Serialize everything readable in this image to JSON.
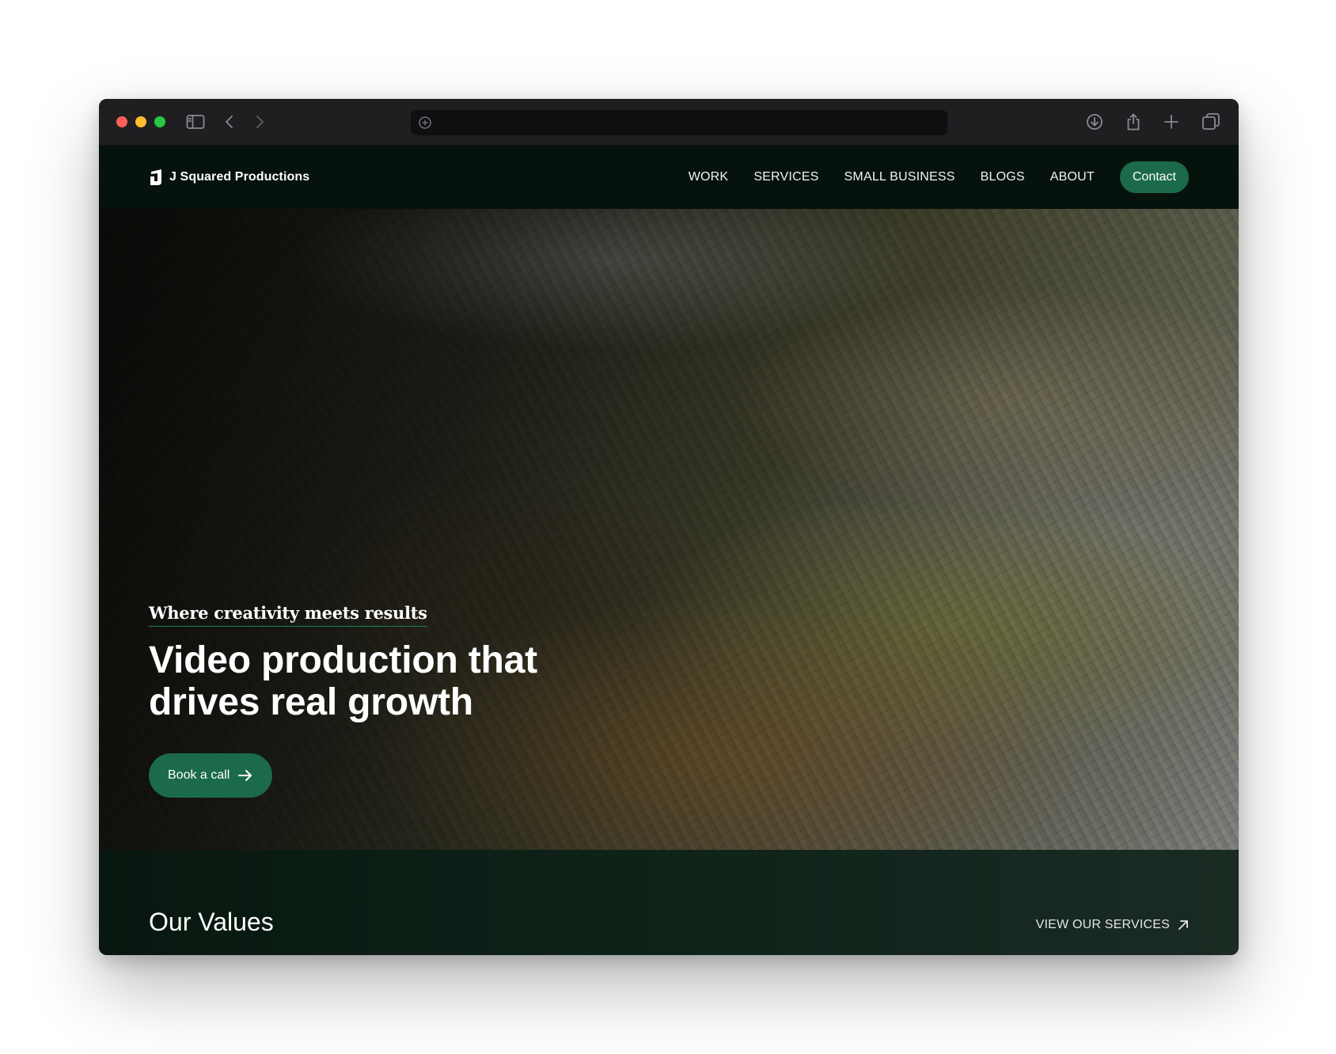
{
  "browser": {
    "icons": [
      "sidebar-icon",
      "back-icon",
      "forward-icon",
      "site-info-icon",
      "download-icon",
      "share-icon",
      "new-tab-icon",
      "tabs-overview-icon"
    ],
    "url": ""
  },
  "nav": {
    "brand": "J Squared Productions",
    "links": [
      "WORK",
      "SERVICES",
      "SMALL BUSINESS",
      "BLOGS",
      "ABOUT"
    ],
    "contact_label": "Contact"
  },
  "hero": {
    "eyebrow": "Where creativity meets results",
    "headline": "Video production that drives real growth",
    "cta_label": "Book a call"
  },
  "values": {
    "title": "Our Values",
    "link_label": "VIEW OUR SERVICES"
  },
  "colors": {
    "accent": "#1b6a4c",
    "nav_bg": "#06130c",
    "section_bg": "#0f2319"
  }
}
